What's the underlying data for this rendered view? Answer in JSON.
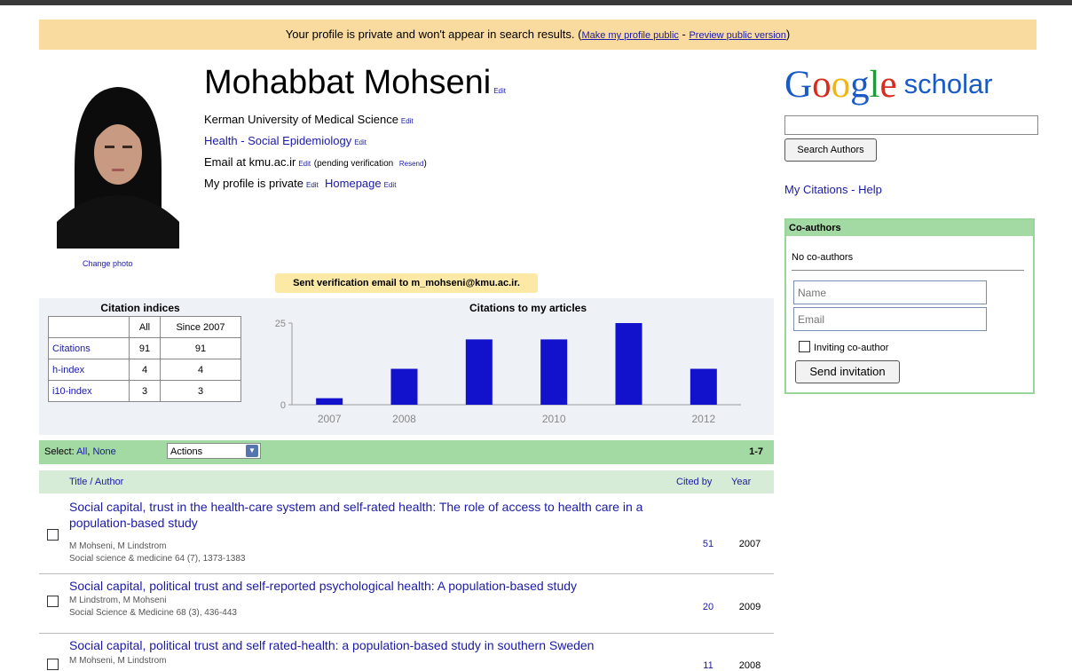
{
  "banner": {
    "message": "Your profile is private and won't appear in search results.",
    "open_paren": " (",
    "make_public_link": "Make my profile public",
    "separator": " - ",
    "preview_link": "Preview public version",
    "close_paren": ")"
  },
  "profile": {
    "name": "Mohabbat Mohseni",
    "edit": "Edit",
    "affiliation": "Kerman University of Medical Science",
    "interests": "Health - Social Epidemiology",
    "email": "Email at kmu.ac.ir",
    "pending": "(pending verification",
    "resend": "Resend",
    "pending_close": ")",
    "private_text": "My profile is private",
    "homepage": "Homepage",
    "change_photo": "Change photo"
  },
  "verification_note": "Sent verification email to m_mohseni@kmu.ac.ir.",
  "citation_indices": {
    "title": "Citation indices",
    "col_all": "All",
    "col_since": "Since 2007",
    "rows": [
      {
        "label": "Citations",
        "all": "91",
        "since": "91"
      },
      {
        "label": "h-index",
        "all": "4",
        "since": "4"
      },
      {
        "label": "i10-index",
        "all": "3",
        "since": "3"
      }
    ]
  },
  "chart_data": {
    "type": "bar",
    "title": "Citations to my articles",
    "categories": [
      "2007",
      "2008",
      "2009",
      "2010",
      "2011",
      "2012"
    ],
    "values": [
      2,
      11,
      20,
      20,
      25,
      11
    ],
    "tick_labels_x": [
      "2007",
      "2008",
      "2010",
      "2012"
    ],
    "yticks": [
      "0",
      "25"
    ],
    "ylim": [
      0,
      25
    ],
    "color": "#1212cc",
    "grid": false
  },
  "list": {
    "select_label": "Select:",
    "all_link": "All",
    "comma": ", ",
    "none_link": "None",
    "actions": "Actions",
    "pager": "1-7",
    "col_title": "Title / Author",
    "col_cited": "Cited by",
    "col_year": "Year"
  },
  "articles": [
    {
      "title": "Social capital, trust in the health-care system and self-rated health: The role of access to health care in a population-based study",
      "authors": "M Mohseni, M Lindstrom",
      "pub": "Social science & medicine 64 (7), 1373-1383",
      "cited": "51",
      "year": "2007"
    },
    {
      "title": "Social capital, political trust and self-reported psychological health: A population-based study",
      "authors": "M Lindstrom, M Mohseni",
      "pub": "Social Science & Medicine 68 (3), 436-443",
      "cited": "20",
      "year": "2009"
    },
    {
      "title": "Social capital, political trust and self rated-health: a population-based study in southern Sweden",
      "authors": "M Mohseni, M Lindstrom",
      "pub": "",
      "cited": "11",
      "year": "2008"
    }
  ],
  "sidebar": {
    "logo_google": "Google",
    "logo_scholar": "scholar",
    "search_button": "Search Authors",
    "my_citations": "My Citations",
    "link_sep": " - ",
    "help": "Help",
    "coauthors_title": "Co-authors",
    "no_coauthors": "No co-authors",
    "name_placeholder": "Name",
    "email_placeholder": "Email",
    "inviting_label": "Inviting co-author",
    "send_button": "Send invitation"
  },
  "colors": {
    "banner": "#f9dba0",
    "green_bar": "#a3d9a3",
    "link": "#1a1aa6"
  }
}
